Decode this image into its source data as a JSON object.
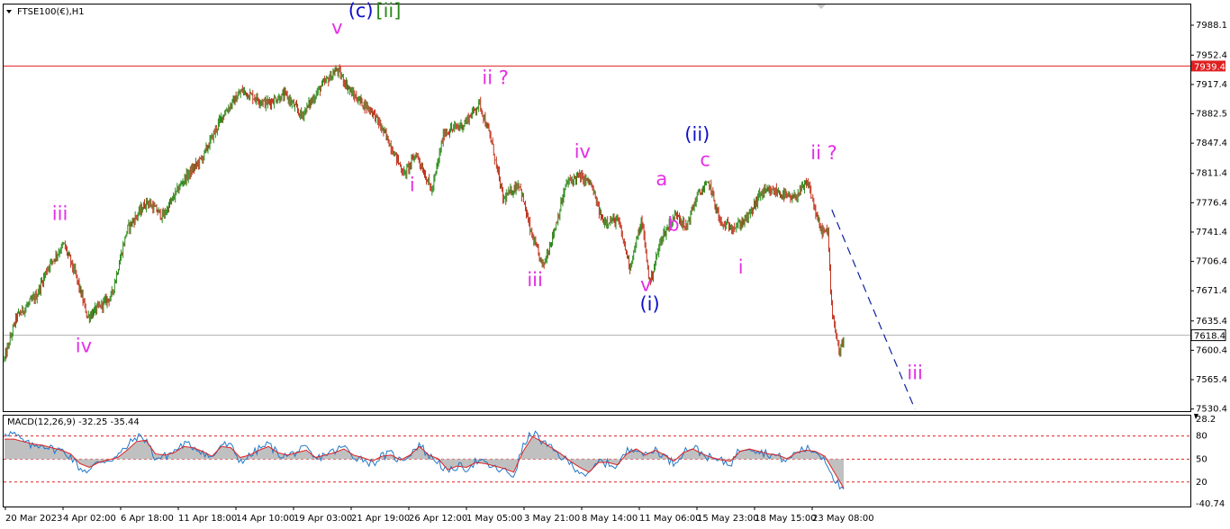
{
  "chart_data": [
    {
      "type": "candlestick",
      "title": "FTSE100(€),H1",
      "ylim": [
        7530.0,
        7988.1
      ],
      "price_ticks": [
        "7988.1",
        "7952.4",
        "7917.4",
        "7882.5",
        "7847.4",
        "7811.4",
        "7776.4",
        "7741.4",
        "7706.4",
        "7671.4",
        "7635.4",
        "7600.4",
        "7565.4",
        "7530.4"
      ],
      "time_labels": [
        "20 Mar 2023",
        "4 Apr 02:00",
        "6 Apr 18:00",
        "11 Apr 18:00",
        "14 Apr 10:00",
        "19 Apr 03:00",
        "21 Apr 19:00",
        "26 Apr 12:00",
        "1 May 05:00",
        "3 May 21:00",
        "8 May 14:00",
        "11 May 06:00",
        "15 May 23:00",
        "18 May 15:00",
        "23 May 08:00"
      ],
      "resistance_line": {
        "price": 7939.4,
        "label": "7939.4",
        "color": "#e02020"
      },
      "current_price": {
        "price": 7618.4,
        "label": "7618.4"
      },
      "price_path": [
        {
          "t": 0,
          "p": 7590
        },
        {
          "t": 3,
          "p": 7640
        },
        {
          "t": 8,
          "p": 7665
        },
        {
          "t": 11,
          "p": 7700
        },
        {
          "t": 15,
          "p": 7727
        },
        {
          "t": 18,
          "p": 7690
        },
        {
          "t": 21,
          "p": 7640
        },
        {
          "t": 27,
          "p": 7665
        },
        {
          "t": 31,
          "p": 7745
        },
        {
          "t": 36,
          "p": 7778
        },
        {
          "t": 40,
          "p": 7760
        },
        {
          "t": 45,
          "p": 7802
        },
        {
          "t": 50,
          "p": 7830
        },
        {
          "t": 55,
          "p": 7880
        },
        {
          "t": 60,
          "p": 7910
        },
        {
          "t": 66,
          "p": 7895
        },
        {
          "t": 71,
          "p": 7905
        },
        {
          "t": 75,
          "p": 7880
        },
        {
          "t": 80,
          "p": 7915
        },
        {
          "t": 84,
          "p": 7935
        },
        {
          "t": 88,
          "p": 7905
        },
        {
          "t": 93,
          "p": 7885
        },
        {
          "t": 97,
          "p": 7850
        },
        {
          "t": 101,
          "p": 7810
        },
        {
          "t": 104,
          "p": 7835
        },
        {
          "t": 108,
          "p": 7790
        },
        {
          "t": 111,
          "p": 7860
        },
        {
          "t": 116,
          "p": 7870
        },
        {
          "t": 120,
          "p": 7895
        },
        {
          "t": 123,
          "p": 7850
        },
        {
          "t": 126,
          "p": 7780
        },
        {
          "t": 130,
          "p": 7800
        },
        {
          "t": 133,
          "p": 7740
        },
        {
          "t": 136,
          "p": 7700
        },
        {
          "t": 139,
          "p": 7745
        },
        {
          "t": 142,
          "p": 7800
        },
        {
          "t": 145,
          "p": 7808
        },
        {
          "t": 148,
          "p": 7800
        },
        {
          "t": 151,
          "p": 7755
        },
        {
          "t": 155,
          "p": 7755
        },
        {
          "t": 158,
          "p": 7700
        },
        {
          "t": 161,
          "p": 7755
        },
        {
          "t": 163,
          "p": 7680
        },
        {
          "t": 166,
          "p": 7735
        },
        {
          "t": 170,
          "p": 7765
        },
        {
          "t": 172,
          "p": 7745
        },
        {
          "t": 175,
          "p": 7785
        },
        {
          "t": 178,
          "p": 7800
        },
        {
          "t": 181,
          "p": 7750
        },
        {
          "t": 185,
          "p": 7748
        },
        {
          "t": 188,
          "p": 7760
        },
        {
          "t": 191,
          "p": 7788
        },
        {
          "t": 195,
          "p": 7790
        },
        {
          "t": 199,
          "p": 7780
        },
        {
          "t": 203,
          "p": 7800
        },
        {
          "t": 206,
          "p": 7745
        },
        {
          "t": 208,
          "p": 7740
        },
        {
          "t": 209,
          "p": 7650
        },
        {
          "t": 211,
          "p": 7595
        },
        {
          "t": 212,
          "p": 7618
        }
      ],
      "wave_labels": [
        {
          "text": "v",
          "t": 84,
          "p": 7978,
          "color": "#e52ee5"
        },
        {
          "text": "(c)",
          "t": 90,
          "p": 7998,
          "color": "#1010cc"
        },
        {
          "text": "[ii]",
          "t": 97,
          "p": 7998,
          "color": "#2a8a1a"
        },
        {
          "text": "iii",
          "t": 14,
          "p": 7756,
          "color": "#e52ee5"
        },
        {
          "text": "iv",
          "t": 20,
          "p": 7598,
          "color": "#e52ee5"
        },
        {
          "text": "ii ?",
          "t": 124,
          "p": 7918,
          "color": "#e52ee5"
        },
        {
          "text": "i",
          "t": 103,
          "p": 7790,
          "color": "#e52ee5"
        },
        {
          "text": "iii",
          "t": 134,
          "p": 7677,
          "color": "#e52ee5"
        },
        {
          "text": "iv",
          "t": 146,
          "p": 7830,
          "color": "#e52ee5"
        },
        {
          "text": "(ii)",
          "t": 175,
          "p": 7850,
          "color": "#1010cc"
        },
        {
          "text": "c",
          "t": 177,
          "p": 7820,
          "color": "#e52ee5"
        },
        {
          "text": "a",
          "t": 166,
          "p": 7797,
          "color": "#e52ee5"
        },
        {
          "text": "b",
          "t": 169,
          "p": 7743,
          "color": "#e52ee5"
        },
        {
          "text": "v",
          "t": 162,
          "p": 7671,
          "color": "#e52ee5"
        },
        {
          "text": "(i)",
          "t": 163,
          "p": 7648,
          "color": "#1010cc"
        },
        {
          "text": "i",
          "t": 186,
          "p": 7692,
          "color": "#e52ee5"
        },
        {
          "text": "ii ?",
          "t": 207,
          "p": 7828,
          "color": "#e52ee5"
        },
        {
          "text": "iii",
          "t": 230,
          "p": 7566,
          "color": "#e52ee5"
        }
      ],
      "projection": {
        "from": {
          "t": 209,
          "p": 7768
        },
        "to": {
          "t": 230,
          "p": 7530
        },
        "color": "#1020a0"
      },
      "colors": {
        "up": "#2a8a1a",
        "down": "#c0301a",
        "grid": "#000000"
      }
    },
    {
      "type": "line",
      "title": "MACD(12,26,9) -32.25 -35.44",
      "ylim": [
        -40.74,
        28.2
      ],
      "ticks": [
        "28.2",
        "80",
        "50",
        "20",
        "-40.74"
      ],
      "levels": [
        {
          "v": 14.5,
          "color": "#e02020"
        },
        {
          "v": -4.3,
          "color": "#e02020"
        },
        {
          "v": -23.0,
          "color": "#e02020"
        }
      ],
      "series": [
        {
          "name": "MACD",
          "color": "#1f78c8",
          "values": [
            18,
            16,
            10,
            6,
            8,
            4,
            3,
            -2,
            -12,
            -14,
            -6,
            -5,
            -2,
            6,
            14,
            12,
            -4,
            -2,
            2,
            8,
            6,
            2,
            -4,
            8,
            6,
            -6,
            -2,
            4,
            8,
            0,
            -2,
            2,
            4,
            -5,
            0,
            2,
            6,
            -2,
            -4,
            -8,
            -2,
            0,
            -6,
            0,
            8,
            -2,
            -6,
            -16,
            -10,
            -12,
            -6,
            -8,
            -12,
            -14,
            -18,
            6,
            18,
            10,
            4,
            -2,
            -8,
            -14,
            -18,
            -6,
            -8,
            -10,
            2,
            6,
            -2,
            4,
            -2,
            -8,
            2,
            6,
            0,
            -4,
            -6,
            -8,
            4,
            6,
            2,
            0,
            -2,
            -6,
            2,
            4,
            2,
            -4,
            -20,
            -32
          ]
        },
        {
          "name": "Signal",
          "color": "#e02020",
          "values": [
            12,
            12,
            10,
            8,
            7,
            5,
            3,
            0,
            -8,
            -11,
            -7,
            -5,
            -3,
            3,
            10,
            11,
            0,
            -1,
            1,
            6,
            5,
            2,
            -2,
            6,
            5,
            -3,
            -1,
            3,
            6,
            1,
            -1,
            1,
            3,
            -3,
            -1,
            1,
            4,
            -1,
            -3,
            -6,
            -2,
            -1,
            -5,
            -1,
            6,
            -1,
            -4,
            -13,
            -10,
            -11,
            -7,
            -8,
            -10,
            -12,
            -15,
            2,
            14,
            10,
            5,
            0,
            -6,
            -11,
            -15,
            -7,
            -7,
            -9,
            0,
            4,
            -1,
            3,
            -1,
            -6,
            1,
            4,
            0,
            -3,
            -5,
            -6,
            2,
            4,
            2,
            0,
            -1,
            -4,
            1,
            3,
            2,
            -2,
            -15,
            -28
          ]
        }
      ]
    }
  ]
}
